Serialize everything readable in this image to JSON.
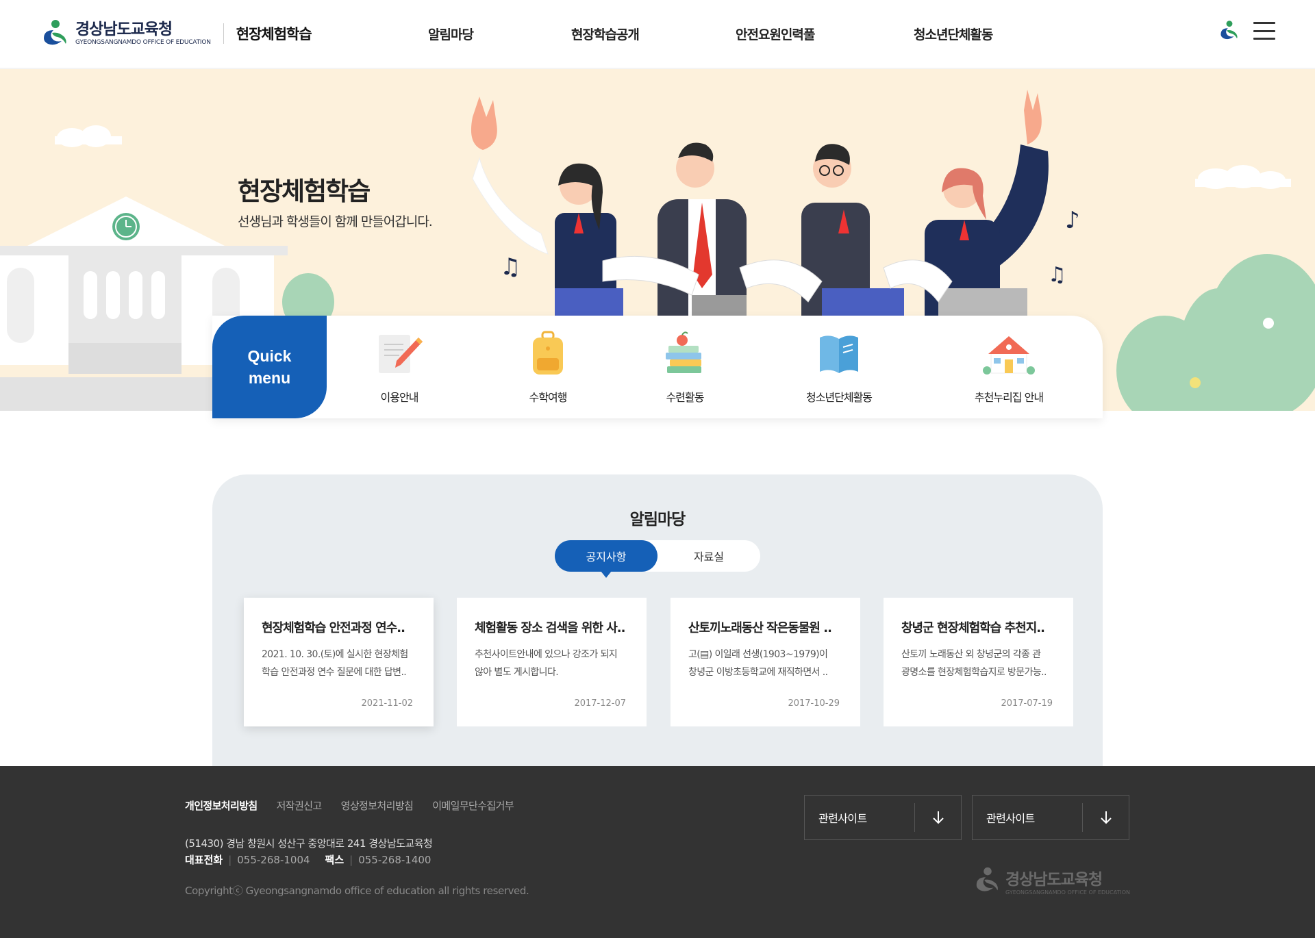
{
  "header": {
    "logo_ko": "경상남도교육청",
    "logo_en": "GYEONGSANGNAMDO OFFICE OF EDUCATION",
    "site_title": "현장체험학습",
    "nav": [
      "알림마당",
      "현장학습공개",
      "안전요원인력풀",
      "청소년단체활동"
    ],
    "menu_icon": "hamburger-icon",
    "emblem_icon": "office-emblem-icon"
  },
  "hero": {
    "title": "현장체험학습",
    "subtitle": "선생님과 학생들이 함께 만들어갑니다.",
    "background_color": "#fdf1dc"
  },
  "quick_menu": {
    "label_line1": "Quick",
    "label_line2": "menu",
    "items": [
      {
        "label": "이용안내",
        "icon": "pencil-note-icon"
      },
      {
        "label": "수학여행",
        "icon": "backpack-icon"
      },
      {
        "label": "수련활동",
        "icon": "books-apple-icon"
      },
      {
        "label": "청소년단체활동",
        "icon": "open-book-icon"
      },
      {
        "label": "추천누리집 안내",
        "icon": "school-house-icon"
      }
    ],
    "accent_color": "#1560b7"
  },
  "notice": {
    "title": "알림마당",
    "tabs": [
      "공지사항",
      "자료실"
    ],
    "active_tab": "공지사항",
    "cards": [
      {
        "title": "현장체험학습 안전과정 연수..",
        "desc_line1": "2021. 10. 30.(토)에 실시한 현장체험",
        "desc_line2": "학습 안전과정 연수 질문에 대한 답변..",
        "date": "2021-11-02"
      },
      {
        "title": "체험활동 장소 검색을 위한 사..",
        "desc_line1": "추천사이트안내에 있으나 강조가 되지",
        "desc_line2": "않아 별도 게시합니다.",
        "date": "2017-12-07"
      },
      {
        "title": "산토끼노래동산 작은동물원 ..",
        "desc_line1": "고(▤) 이일래 선생(1903~1979)이",
        "desc_line2": "창녕군 이방초등학교에 재직하면서 ..",
        "date": "2017-10-29"
      },
      {
        "title": "창녕군 현장체험학습 추천지..",
        "desc_line1": "산토끼 노래동산 외 창녕군의 각종 관",
        "desc_line2": "광명소를 현장체험학습지로 방문가능..",
        "date": "2017-07-19"
      }
    ]
  },
  "footer": {
    "links": [
      "개인정보처리방침",
      "저작권신고",
      "영상정보처리방침",
      "이메일무단수집거부"
    ],
    "address": "(51430) 경남 창원시 성산구 중앙대로 241 경상남도교육청",
    "phone_label": "대표전화",
    "phone": "055-268-1004",
    "fax_label": "팩스",
    "fax": "055-268-1400",
    "copyright": "Copyrightⓒ Gyeongsangnamdo office of education all rights reserved.",
    "related_sites": [
      "관련사이트",
      "관련사이트"
    ],
    "logo_ko": "경상남도교육청",
    "logo_en": "GYEONGSANGNAMDO OFFICE OF EDUCATION"
  }
}
